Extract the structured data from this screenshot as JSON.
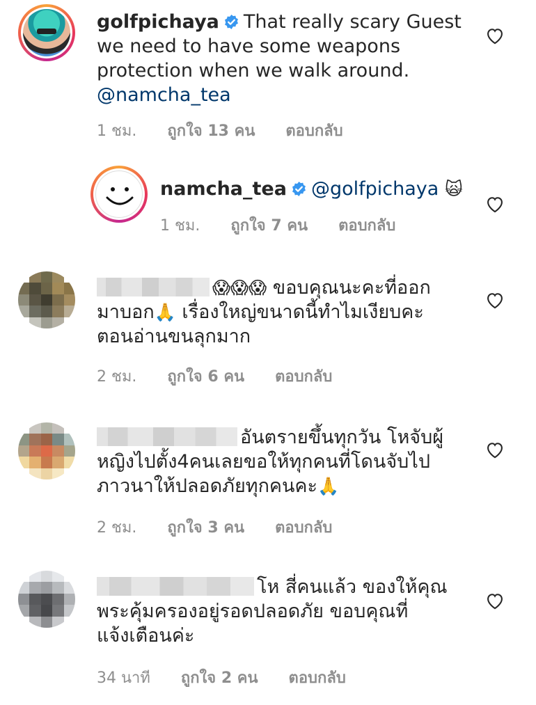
{
  "comments": [
    {
      "username": "golfpichaya",
      "verified": true,
      "text": "That really scary Guest we need to have some weapons protection when we walk around.",
      "mention": "@namcha_tea",
      "time": "1 ชม.",
      "likes": "ถูกใจ 13 คน",
      "reply": "ตอบกลับ"
    },
    {
      "username": "namcha_tea",
      "verified": true,
      "mention": "@golfpichaya",
      "emoji": "🙀",
      "time": "1 ชม.",
      "likes": "ถูกใจ 7 คน",
      "reply": "ตอบกลับ"
    },
    {
      "emoji_prefix": "😱😱😱",
      "text_line1": "ขอบคุณนะคะที่ออก",
      "text_line2a": "มาบอก",
      "emoji_mid": "🙏",
      "text_line2b": " เรื่องใหญ่ขนาดนี้ทำไมเงียบคะ",
      "text_line3": "ตอนอ่านขนลุกมาก",
      "time": "2 ชม.",
      "likes": "ถูกใจ 6 คน",
      "reply": "ตอบกลับ"
    },
    {
      "text_line1": "อันตรายขึ้นทุกวัน โหจับผู้",
      "text_line2": "หญิงไปตั้ง4คนเลยขอให้ทุกคนที่โดนจับไป",
      "text_line3": "ภาวนาให้ปลอดภัยทุกคนคะ",
      "emoji_end": "🙏",
      "time": "2 ชม.",
      "likes": "ถูกใจ 3 คน",
      "reply": "ตอบกลับ"
    },
    {
      "text_line1": "โห สี่คนแล้ว ของให้คุณ",
      "text_line2": "พระคุ้มครองอยู่รอดปลอดภัย ขอบคุณที่",
      "text_line3": "แจ้งเตือนค่ะ",
      "time": "34 นาที",
      "likes": "ถูกใจ 2 คน",
      "reply": "ตอบกลับ"
    }
  ],
  "colors": {
    "text": "#262626",
    "meta": "#8e8e8e",
    "mention": "#00376b",
    "verified": "#3897f0"
  }
}
